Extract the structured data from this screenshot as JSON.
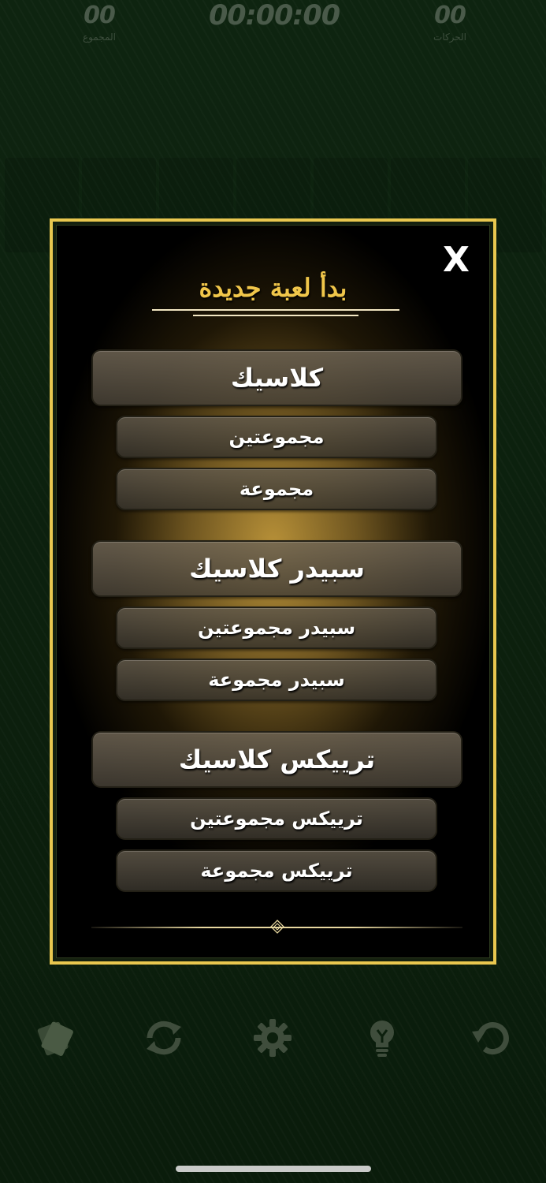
{
  "header": {
    "total_value": "00",
    "total_label": "المجموع",
    "timer": "00:00:00",
    "moves_value": "00",
    "moves_label": "الحركات"
  },
  "dialog": {
    "close_label": "X",
    "title": "بدأ لعبة جديدة",
    "groups": [
      {
        "main_label": "كلاسيك",
        "options": [
          "مجموعتين",
          "مجموعة"
        ]
      },
      {
        "main_label": "سبيدر كلاسيك",
        "options": [
          "سبيدر مجموعتين",
          "سبيدر مجموعة"
        ]
      },
      {
        "main_label": "ترييكس كلاسيك",
        "options": [
          "ترييكس مجموعتين",
          "ترييكس مجموعة"
        ]
      }
    ]
  },
  "toolbar": {
    "icons": [
      "cards-icon",
      "shuffle-icon",
      "gear-icon",
      "lightbulb-icon",
      "undo-icon"
    ]
  },
  "colors": {
    "accent_gold": "#e9c74f",
    "title_gold": "#f0c64a",
    "background_green": "#0c1f0d"
  }
}
